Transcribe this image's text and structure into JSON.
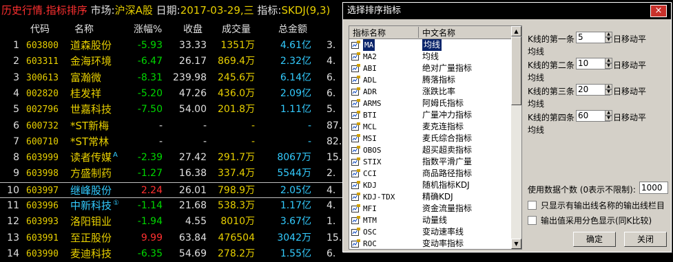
{
  "window": {
    "title_left": "历史行情.指标排序",
    "market_label": " 市场:",
    "market_value": "沪深A股",
    "date_label": " 日期:",
    "date_value": "2017-03-29,三",
    "indicator_label": " 指标:",
    "indicator_value": "SKDJ(9,3)"
  },
  "table": {
    "headers": [
      "代码",
      "名称",
      "涨幅%",
      "收盘",
      "成交量",
      "总金额"
    ],
    "rows": [
      {
        "idx": "1",
        "code": "603800",
        "name": "道森股份",
        "chg": "-5.93",
        "close": "33.33",
        "vol": "1351万",
        "amt": "4.61亿",
        "last": "3."
      },
      {
        "idx": "2",
        "code": "603311",
        "name": "金海环境",
        "chg": "-6.47",
        "close": "26.17",
        "vol": "869.4万",
        "amt": "2.32亿",
        "last": "4."
      },
      {
        "idx": "3",
        "code": "300613",
        "name": "富瀚微",
        "chg": "-8.31",
        "close": "239.98",
        "vol": "245.6万",
        "amt": "6.14亿",
        "last": "6."
      },
      {
        "idx": "4",
        "code": "002820",
        "name": "桂发祥",
        "chg": "-5.20",
        "close": "47.26",
        "vol": "436.0万",
        "amt": "2.09亿",
        "last": "6."
      },
      {
        "idx": "5",
        "code": "002796",
        "name": "世嘉科技",
        "chg": "-7.50",
        "close": "54.00",
        "vol": "201.8万",
        "amt": "1.11亿",
        "last": "5."
      },
      {
        "idx": "6",
        "code": "600732",
        "name": "*ST新梅",
        "chg": "-",
        "close": "-",
        "vol": "-",
        "amt": "-",
        "last": "87."
      },
      {
        "idx": "7",
        "code": "600710",
        "name": "*ST常林",
        "chg": "-",
        "close": "-",
        "vol": "-",
        "amt": "-",
        "last": "82."
      },
      {
        "idx": "8",
        "code": "603999",
        "name": "读者传媒",
        "chg": "-2.39",
        "close": "27.42",
        "vol": "291.7万",
        "amt": "8067万",
        "last": "15."
      },
      {
        "idx": "9",
        "code": "603998",
        "name": "方盛制药",
        "chg": "-1.27",
        "close": "16.38",
        "vol": "337.4万",
        "amt": "5544万",
        "last": "2."
      },
      {
        "idx": "10",
        "code": "603997",
        "name": "继峰股份",
        "chg": "2.24",
        "close": "26.01",
        "vol": "798.9万",
        "amt": "2.05亿",
        "last": "4."
      },
      {
        "idx": "11",
        "code": "603996",
        "name": "中新科技",
        "chg": "-1.14",
        "close": "21.68",
        "vol": "538.3万",
        "amt": "1.17亿",
        "last": "4."
      },
      {
        "idx": "12",
        "code": "603993",
        "name": "洛阳钼业",
        "chg": "-1.94",
        "close": "4.55",
        "vol": "8010万",
        "amt": "3.67亿",
        "last": "1."
      },
      {
        "idx": "13",
        "code": "603991",
        "name": "至正股份",
        "chg": "9.99",
        "close": "63.84",
        "vol": "476504",
        "amt": "3042万",
        "last": "15."
      },
      {
        "idx": "14",
        "code": "603990",
        "name": "麦迪科技",
        "chg": "-6.35",
        "close": "54.69",
        "vol": "278.2万",
        "amt": "1.55亿",
        "last": "6."
      }
    ],
    "name_marks": {
      "8": "A",
      "11": "①"
    }
  },
  "dialog": {
    "title": "选择排序指标",
    "close_icon": "×",
    "list_headers": {
      "name": "指标名称",
      "cn": "中文名称"
    },
    "indicators": [
      {
        "name": "MA",
        "cn": "均线",
        "selected": true
      },
      {
        "name": "MA2",
        "cn": "均线"
      },
      {
        "name": "ABI",
        "cn": "绝对广量指标"
      },
      {
        "name": "ADL",
        "cn": "腾落指标"
      },
      {
        "name": "ADR",
        "cn": "涨跌比率"
      },
      {
        "name": "ARMS",
        "cn": "阿姆氏指标"
      },
      {
        "name": "BTI",
        "cn": "广量冲力指标"
      },
      {
        "name": "MCL",
        "cn": "麦克连指标"
      },
      {
        "name": "MSI",
        "cn": "麦氏综合指标"
      },
      {
        "name": "OBOS",
        "cn": "超买超卖指标"
      },
      {
        "name": "STIX",
        "cn": "指数平滑广量"
      },
      {
        "name": "CCI",
        "cn": "商品路径指标"
      },
      {
        "name": "KDJ",
        "cn": "随机指标KDJ"
      },
      {
        "name": "KDJ-TDX",
        "cn": "精确KDJ"
      },
      {
        "name": "MFI",
        "cn": "资金流量指标"
      },
      {
        "name": "MTM",
        "cn": "动量线"
      },
      {
        "name": "OSC",
        "cn": "变动速率线"
      },
      {
        "name": "ROC",
        "cn": "变动率指标"
      }
    ],
    "params": [
      {
        "label": "K线的第一条",
        "value": "5",
        "suffix": "日移动平",
        "wrap": "均线"
      },
      {
        "label": "K线的第二条",
        "value": "10",
        "suffix": "日移动平",
        "wrap": "均线"
      },
      {
        "label": "K线的第三条",
        "value": "20",
        "suffix": "日移动平",
        "wrap": "均线"
      },
      {
        "label": "K线的第四条",
        "value": "60",
        "suffix": "日移动平",
        "wrap": "均线"
      }
    ],
    "count_label": "使用数据个数 (0表示不限制):",
    "count_value": "1000",
    "check1": "只显示有输出线名称的输出线栏目",
    "check2": "输出值采用分色显示(同K比较)",
    "ok": "确定",
    "cancel": "关闭"
  },
  "colors": {
    "bg": "#000000",
    "up": "#ff3030",
    "down": "#00d800",
    "code": "#e8d000",
    "amount": "#33ccff",
    "selection": "#0a246a"
  }
}
